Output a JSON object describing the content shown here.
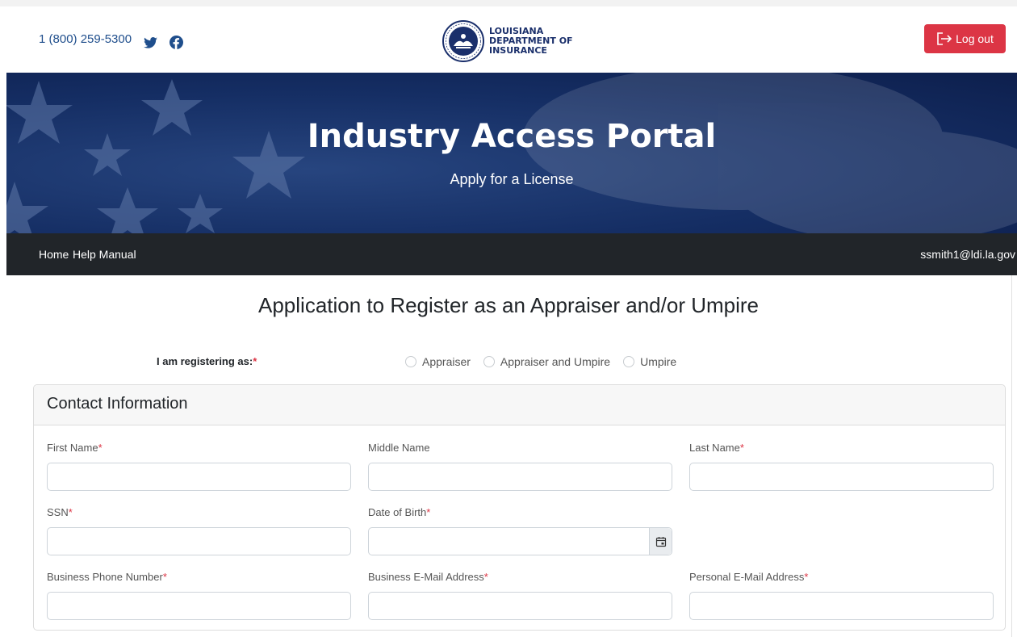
{
  "header": {
    "phone": "1 (800) 259-5300",
    "logo_lines": [
      "LOUISIANA",
      "DEPARTMENT OF",
      "INSURANCE"
    ],
    "logout_label": "Log out"
  },
  "hero": {
    "title": "Industry Access Portal",
    "subtitle": "Apply for a License"
  },
  "nav": {
    "home": "Home",
    "help": "Help Manual",
    "user": "ssmith1@ldi.la.gov"
  },
  "page": {
    "heading": "Application to Register as an Appraiser and/or Umpire",
    "registering_label": "I am registering as:",
    "registering_options": [
      "Appraiser",
      "Appraiser and Umpire",
      "Umpire"
    ]
  },
  "contact": {
    "title": "Contact Information",
    "fields": {
      "first_name": "First Name",
      "middle_name": "Middle Name",
      "last_name": "Last Name",
      "ssn": "SSN",
      "dob": "Date of Birth",
      "business_phone": "Business Phone Number",
      "business_email": "Business E-Mail Address",
      "personal_email": "Personal E-Mail Address"
    },
    "required_mark": "*"
  },
  "colors": {
    "danger": "#dc3545",
    "navbar": "#212529",
    "hero": "#152e64",
    "link": "#1f4e8c"
  },
  "icons": [
    "twitter-icon",
    "facebook-icon",
    "logout-icon",
    "calendar-icon",
    "state-seal-icon"
  ]
}
